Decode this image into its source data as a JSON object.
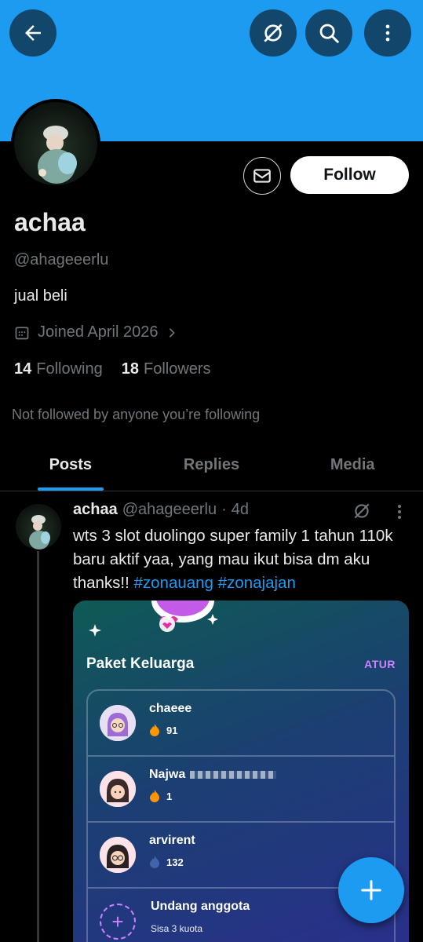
{
  "header": {
    "back_icon": "arrow-left-icon",
    "grok_icon": "grok-icon",
    "search_icon": "search-icon",
    "more_icon": "more-vertical-icon",
    "banner_color": "#1d9bf0"
  },
  "profile": {
    "name": "achaa",
    "handle": "@ahageeerlu",
    "bio": "jual beli",
    "joined": "Joined April 2026",
    "following_count": "14",
    "following_label": "Following",
    "followers_count": "18",
    "followers_label": "Followers",
    "not_followed_text": "Not followed by anyone you’re following",
    "follow_button": "Follow"
  },
  "tabs": [
    {
      "label": "Posts",
      "active": true
    },
    {
      "label": "Replies",
      "active": false
    },
    {
      "label": "Media",
      "active": false
    }
  ],
  "post": {
    "author_name": "achaa",
    "author_handle": "@ahageeerlu",
    "separator": "·",
    "time": "4d",
    "text_plain": "wts 3 slot duolingo super family 1 tahun 110k baru aktif yaa, yang mau ikut bisa dm aku thanks!!",
    "hashtags": [
      "#zonauang",
      "#zonajajan"
    ],
    "media": {
      "title": "Paket Keluarga",
      "action": "ATUR",
      "members": [
        {
          "name": "chaeee",
          "streak": "91"
        },
        {
          "name": "Najwa",
          "streak": "1"
        },
        {
          "name": "arvirent",
          "streak": "132"
        }
      ],
      "invite_label": "Undang anggota",
      "invite_sub": "Sisa 3 kuota"
    }
  },
  "colors": {
    "accent": "#1d9bf0",
    "muted": "#71767b",
    "text": "#e7e9ea",
    "duo_purple": "#ce82ff",
    "flame": "#ff9600"
  }
}
